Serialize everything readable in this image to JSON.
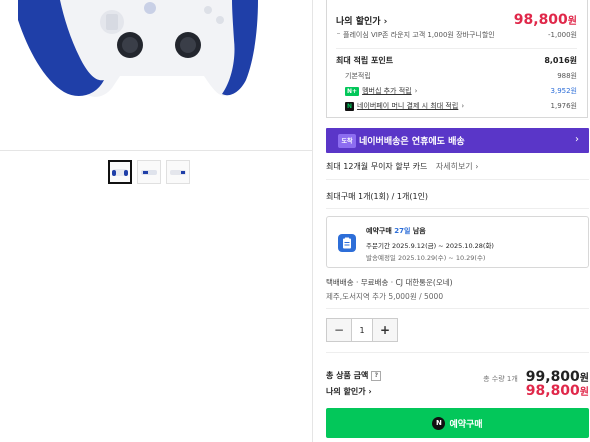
{
  "price_box": {
    "my_discount_label": "나의 할인가",
    "my_discount_value": "98,800",
    "currency": "원",
    "vip_label": "플레이심 VIP존 라운지 고객 1,000원 장바구니할인",
    "vip_value": "-1,000원",
    "points_title": "최대 적립 포인트",
    "points_total": "8,016원",
    "basic_label": "기본적립",
    "basic_value": "988원",
    "membership_label": "멤버십 추가 적립",
    "membership_value": "3,952원",
    "naverpay_label": "네이버페이 머니 결제 시 최대 적립",
    "naverpay_value": "1,976원"
  },
  "banner": {
    "logo": "도착",
    "text": "네이버배송은 연휴에도 배송"
  },
  "installment": {
    "text": "최대 12개월 무이자 할부 카드",
    "more": "자세히보기"
  },
  "max_buy": "최대구매 1개(1회) / 1개(1인)",
  "preorder": {
    "title_prefix": "예약구매",
    "days": "27일",
    "title_suffix": "남음",
    "period": "주문기간  2025.9.12(금) ~ 2025.10.28(화)",
    "ship_date": "발송예정일  2025.10.29(수) ~ 10.29(수)"
  },
  "shipping": {
    "line1": "택배배송  ·  무료배송  ·  CJ 대한통운(오네)",
    "line2": "제주,도서지역 추가 5,000원 / 5000"
  },
  "stepper": {
    "minus": "−",
    "qty": "1",
    "plus": "+"
  },
  "total": {
    "label": "총 상품 금액",
    "help": "?",
    "qty": "총 수량 1개",
    "value": "99,800",
    "currency": "원"
  },
  "mine": {
    "label": "나의 할인가",
    "value": "98,800",
    "currency": "원"
  },
  "buy_button": {
    "icon": "N",
    "label": "예약구매"
  },
  "colors": {
    "accent_red": "#e0284a",
    "naver_green": "#03c75a",
    "banner_purple": "#5a36c8",
    "link_blue": "#2d6ed8"
  }
}
